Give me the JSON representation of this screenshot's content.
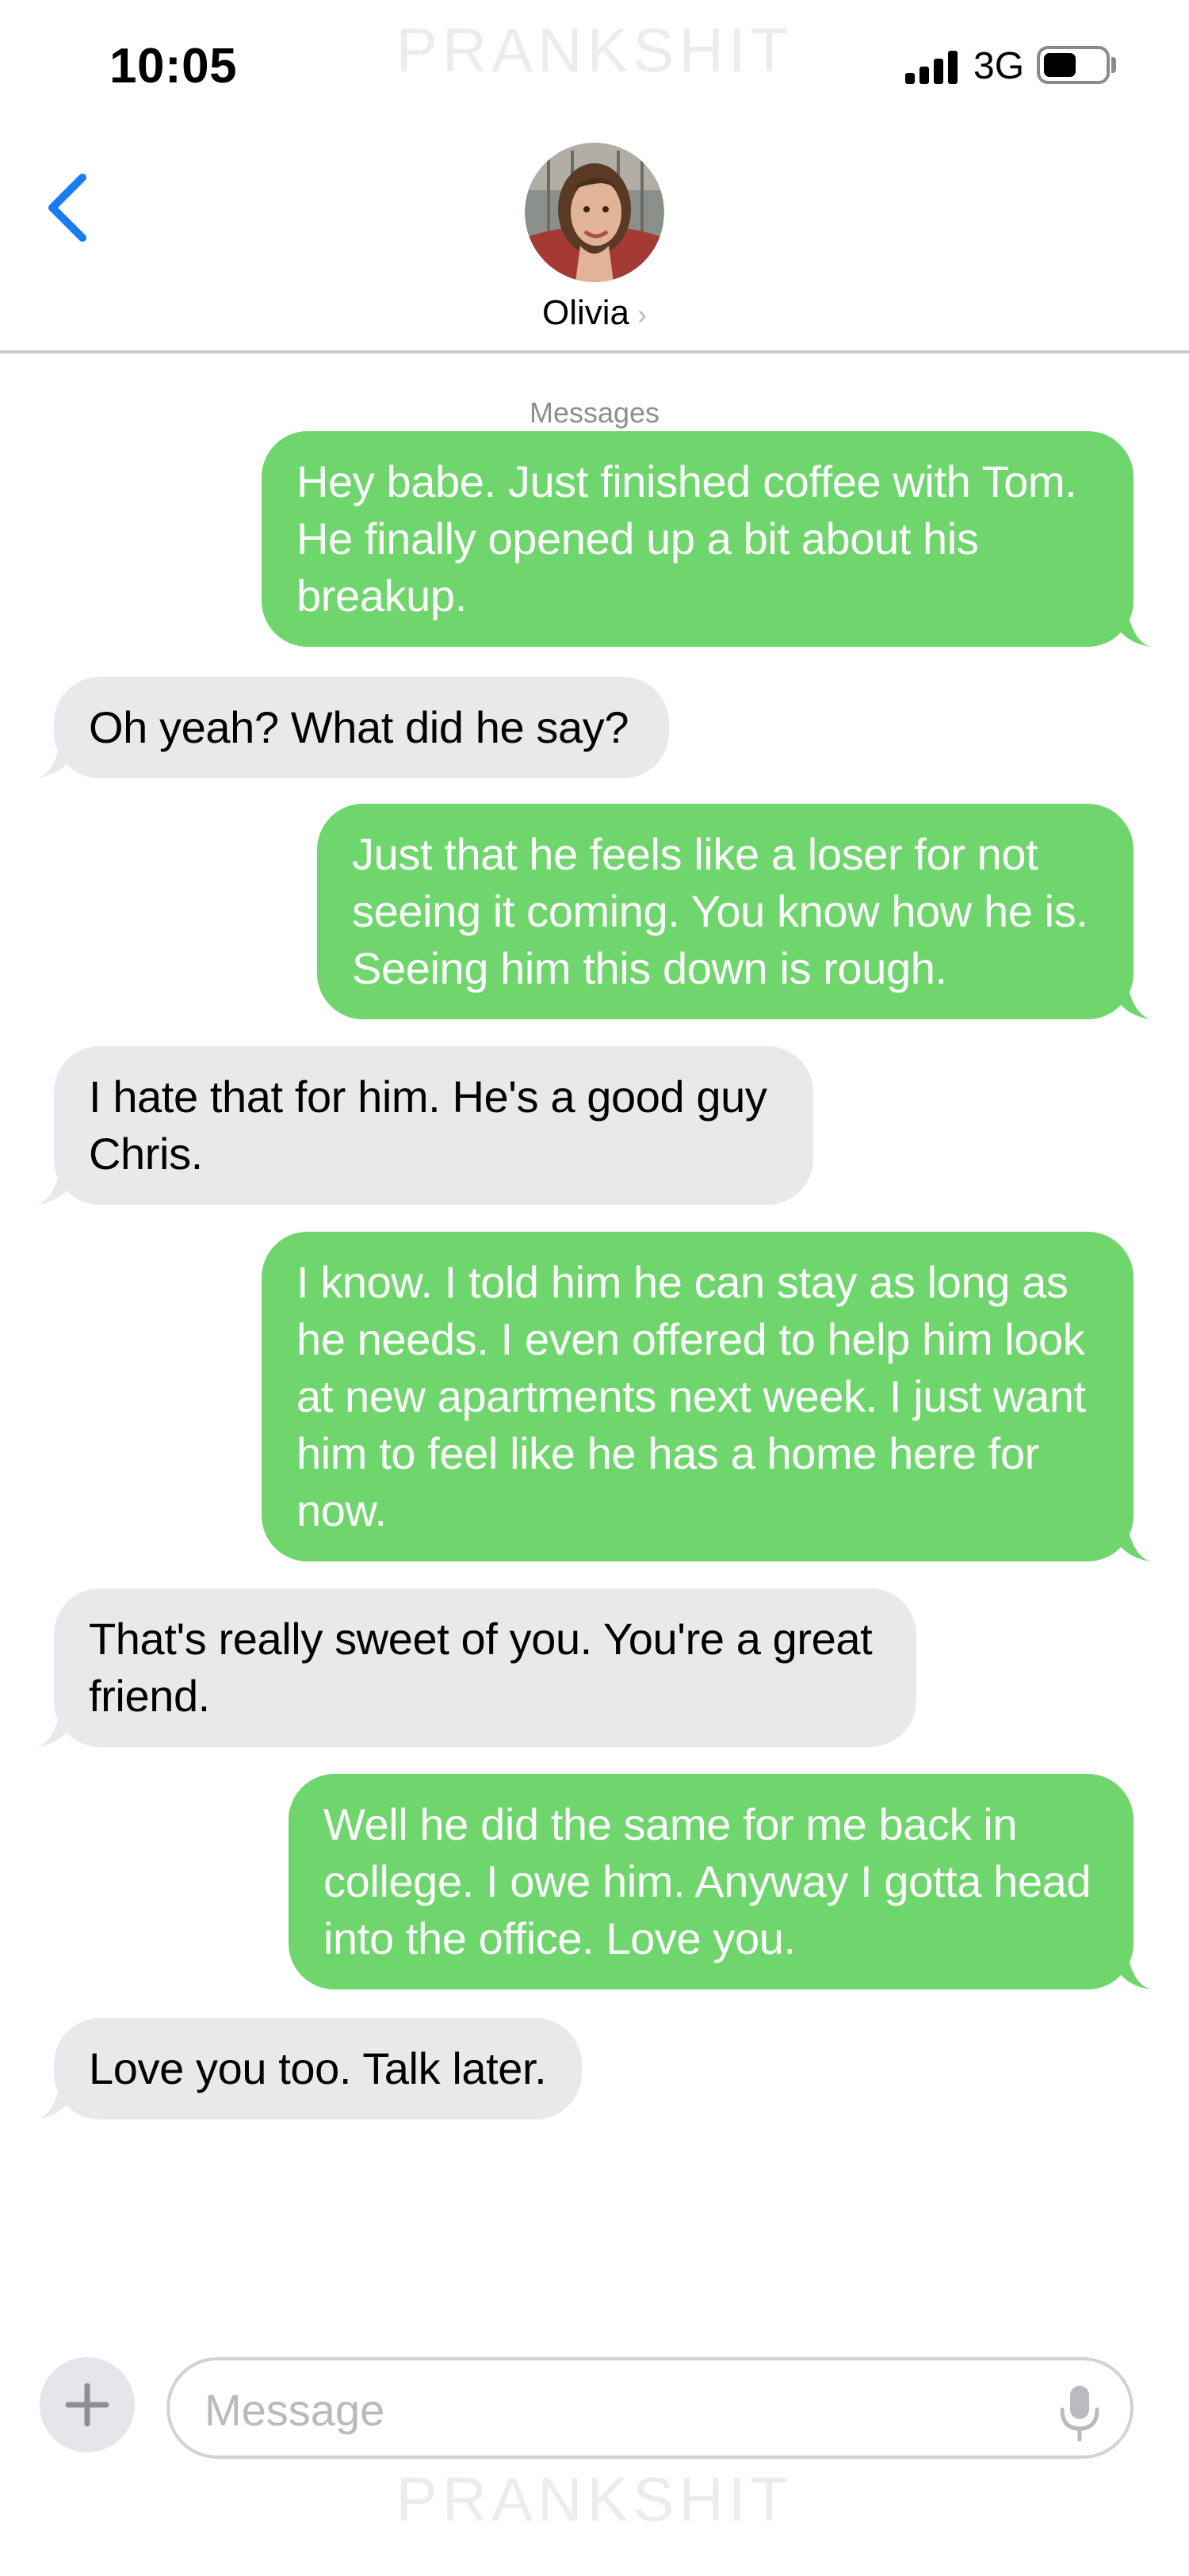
{
  "status_bar": {
    "time": "10:05",
    "network": "3G",
    "watermark": "PRANKSHIT"
  },
  "header": {
    "back_icon": "chevron-left-icon",
    "contact_name": "Olivia",
    "contact_chevron": "›",
    "section_label": "Messages"
  },
  "messages": [
    {
      "side": "out",
      "lines": [
        "Hey babe. Just finished coffee with Tom.",
        "He finally opened up a bit about his",
        "breakup."
      ]
    },
    {
      "side": "in",
      "lines": [
        "Oh yeah? What did he say?"
      ]
    },
    {
      "side": "out",
      "lines": [
        "Just that he feels like a loser for not",
        "seeing it coming. You know how he is.",
        "Seeing him this down is rough."
      ]
    },
    {
      "side": "in",
      "lines": [
        "I hate that for him. He's a good guy",
        "Chris."
      ]
    },
    {
      "side": "out",
      "lines": [
        "I know. I told him he can stay as long as",
        "he needs. I even offered to help him look",
        "at new apartments next week. I just want",
        "him to feel like he has a home here for",
        "now."
      ]
    },
    {
      "side": "in",
      "lines": [
        "That's really sweet of you. You're a great",
        "friend."
      ]
    },
    {
      "side": "out",
      "lines": [
        "Well he did the same for me back in",
        "college. I owe him. Anyway I gotta head",
        "into the office. Love you."
      ]
    },
    {
      "side": "in",
      "lines": [
        "Love you too. Talk later."
      ]
    }
  ],
  "composer": {
    "placeholder": "Message",
    "plus_icon": "plus-icon",
    "mic_icon": "microphone-icon"
  },
  "colors": {
    "outgoing": "#6fd66d",
    "incoming": "#e9e9eb",
    "accent": "#1a7cf5"
  }
}
